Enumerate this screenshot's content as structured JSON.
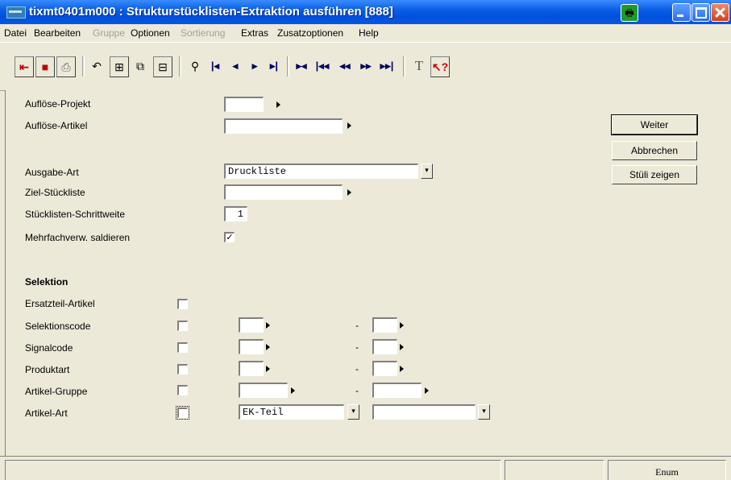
{
  "window": {
    "title": "tixmt0401m000 : Strukturstücklisten-Extraktion ausführen [888]"
  },
  "menu": [
    "Datei",
    "Bearbeiten",
    "Gruppe",
    "Optionen",
    "Sortierung",
    "Extras",
    "Zusatzoptionen",
    "Help"
  ],
  "form": {
    "aufloese_projekt_label": "Auflöse-Projekt",
    "aufloese_artikel_label": "Auflöse-Artikel",
    "ausgabe_art_label": "Ausgabe-Art",
    "ausgabe_art_value": "Druckliste",
    "ziel_stueckliste_label": "Ziel-Stückliste",
    "schrittweite_label": "Stücklisten-Schrittweite",
    "schrittweite_value": "1",
    "mehrfach_label": "Mehrfachverw. saldieren",
    "mehrfach_checked": "✓"
  },
  "selektion": {
    "heading": "Selektion",
    "ersatzteil_label": "Ersatzteil-Artikel",
    "selektionscode_label": "Selektionscode",
    "signalcode_label": "Signalcode",
    "produktart_label": "Produktart",
    "artikel_gruppe_label": "Artikel-Gruppe",
    "artikel_art_label": "Artikel-Art",
    "artikel_art_from_value": "EK-Teil",
    "range_separator": "-"
  },
  "buttons": {
    "weiter": "Weiter",
    "abbrechen": "Abbrechen",
    "stueli_zeigen": "Stüli zeigen"
  },
  "status": {
    "mode": "Enum"
  }
}
